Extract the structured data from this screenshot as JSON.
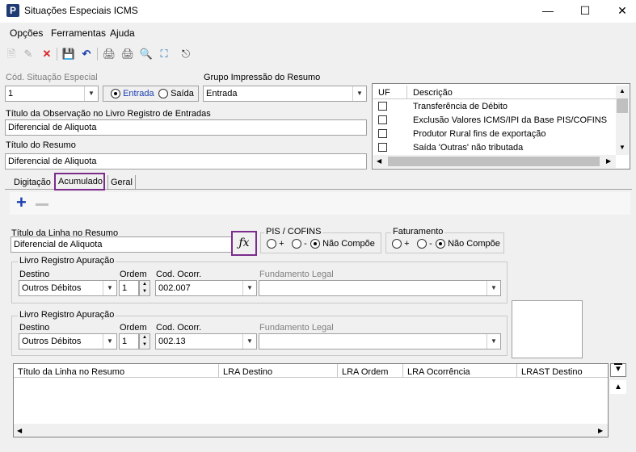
{
  "window": {
    "title": "Situações Especiais ICMS",
    "app_icon": "P"
  },
  "menu": [
    "Opções",
    "Ferramentas",
    "Ajuda"
  ],
  "toolbar_icons": [
    "new-icon",
    "edit-icon",
    "delete-icon",
    "save-icon",
    "undo-icon",
    "print-icon",
    "print-preview-icon",
    "search-icon",
    "zoom-icon",
    "exit-icon"
  ],
  "form": {
    "cod_label": "Cód. Situação Especial",
    "cod_value": "1",
    "entrada_label": "Entrada",
    "saida_label": "Saída",
    "grupo_label": "Grupo Impressão do Resumo",
    "grupo_value": "Entrada",
    "obs_label": "Título da Observação no Livro Registro de Entradas",
    "obs_value": "Diferencial de Aliquota",
    "resumo_label": "Título do Resumo",
    "resumo_value": "Diferencial de Aliquota"
  },
  "uf_table": {
    "headers": [
      "UF",
      "Descrição"
    ],
    "rows": [
      "Transferência de Débito",
      "Exclusão Valores ICMS/IPI da Base PIS/COFINS",
      "Produtor Rural fins de exportação",
      "Saída 'Outras' não tributada"
    ]
  },
  "tabs": [
    "Digitação",
    "Acumulado",
    "Geral"
  ],
  "acumulado": {
    "linha_label": "Título da Linha no Resumo",
    "linha_value": "Diferencial de Aliquota",
    "fx": "ƒx",
    "pis_label": "PIS / COFINS",
    "fat_label": "Faturamento",
    "plus": "+",
    "minus": "-",
    "nao_compoe": "Não Compõe",
    "lra1": {
      "title": "Livro Registro Apuração",
      "destino_label": "Destino",
      "destino": "Outros Débitos",
      "ordem_label": "Ordem",
      "ordem": "1",
      "cod_label": "Cod. Ocorr.",
      "cod": "002.007",
      "fund_label": "Fundamento Legal"
    },
    "lra2": {
      "title": "Livro Registro Apuração",
      "destino_label": "Destino",
      "destino": "Outros Débitos",
      "ordem_label": "Ordem",
      "ordem": "1",
      "cod_label": "Cod. Ocorr.",
      "cod": "002.13",
      "fund_label": "Fundamento Legal"
    }
  },
  "grid": {
    "headers": [
      "Título da Linha no Resumo",
      "LRA Destino",
      "LRA Ordem",
      "LRA Ocorrência",
      "LRAST Destino"
    ]
  },
  "colors": {
    "highlight": "#7b2c8c",
    "plus": "#1a3fb0"
  }
}
